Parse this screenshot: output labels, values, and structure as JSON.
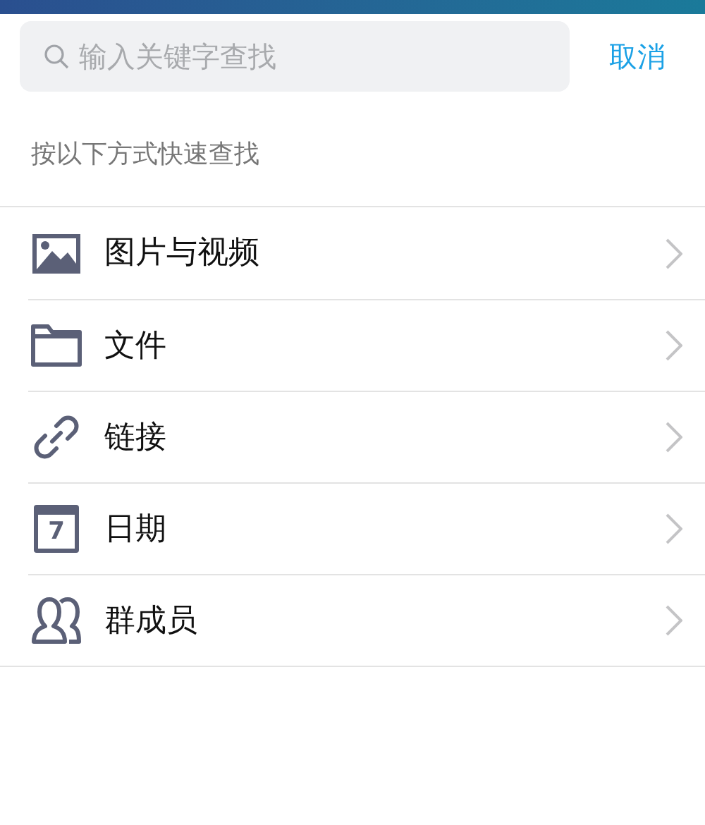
{
  "search": {
    "placeholder": "输入关键字查找",
    "cancel": "取消"
  },
  "hint": "按以下方式快速查找",
  "items": [
    {
      "kind": "image",
      "label": "图片与视频"
    },
    {
      "kind": "folder",
      "label": "文件"
    },
    {
      "kind": "link",
      "label": "链接"
    },
    {
      "kind": "calendar",
      "label": "日期",
      "day": "7"
    },
    {
      "kind": "people",
      "label": "群成员"
    }
  ]
}
